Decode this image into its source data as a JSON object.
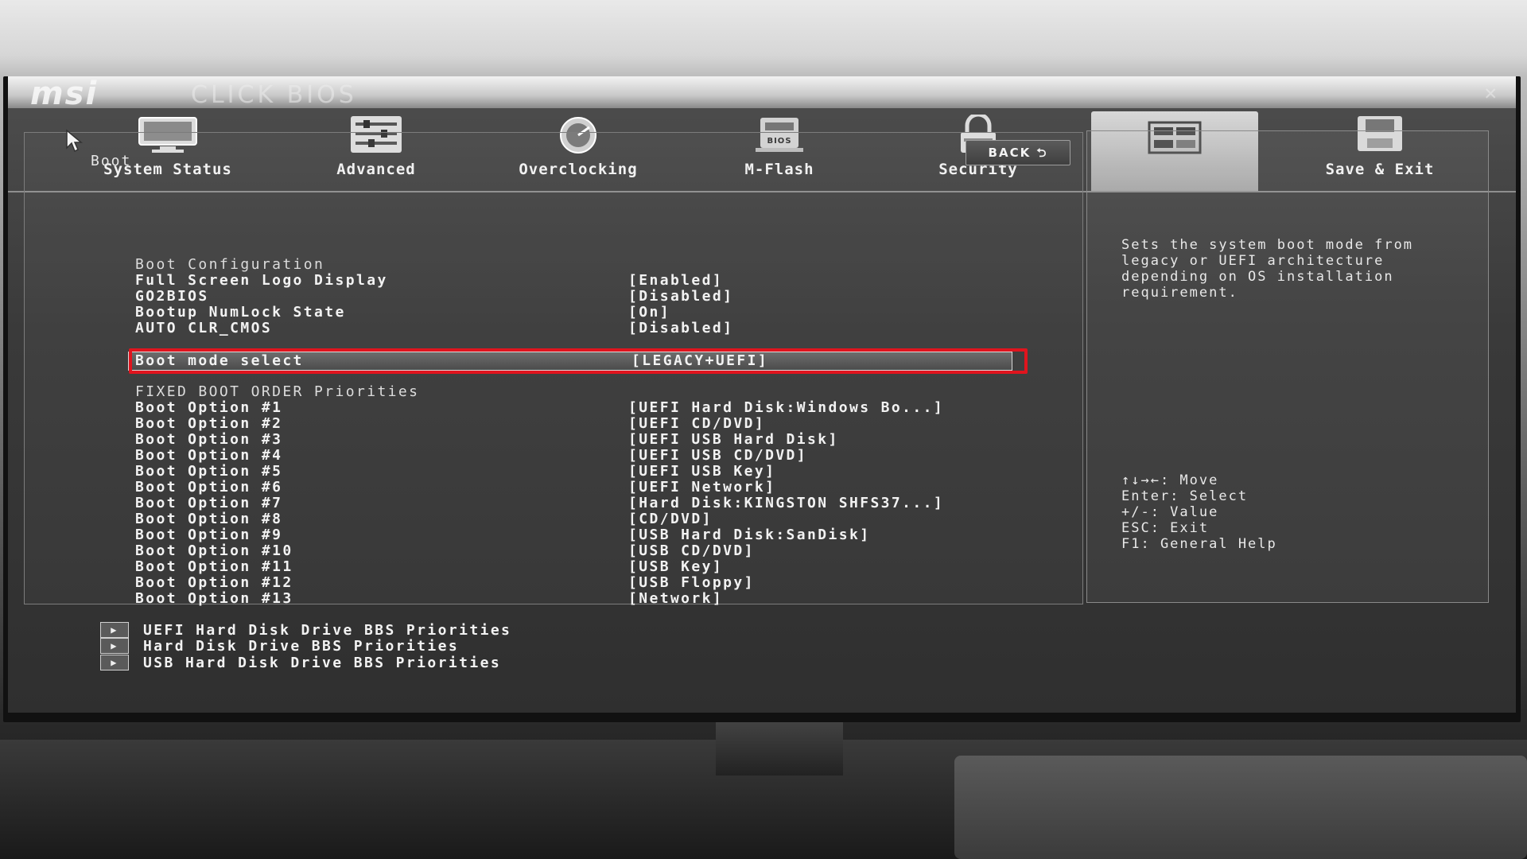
{
  "brand": {
    "logo": "msi",
    "subtitle": "CLICK BIOS",
    "close_icon": "close-icon"
  },
  "tabs": [
    {
      "label": "System Status",
      "icon": "monitor-icon"
    },
    {
      "label": "Advanced",
      "icon": "sliders-icon"
    },
    {
      "label": "Overclocking",
      "icon": "gauge-icon"
    },
    {
      "label": "M-Flash",
      "icon": "bios-chip-icon"
    },
    {
      "label": "Security",
      "icon": "lock-icon"
    },
    {
      "label": "",
      "icon": "boot-icon",
      "active": true
    },
    {
      "label": "Save & Exit",
      "icon": "disk-icon"
    }
  ],
  "boot": {
    "section_title": "Boot",
    "back_label": "BACK ⮌",
    "config_header": "Boot Configuration",
    "settings": [
      {
        "label": "Full Screen Logo Display",
        "value": "[Enabled]"
      },
      {
        "label": "GO2BIOS",
        "value": "[Disabled]"
      },
      {
        "label": "Bootup NumLock State",
        "value": "[On]"
      },
      {
        "label": "AUTO CLR_CMOS",
        "value": "[Disabled]"
      }
    ],
    "selected": {
      "label": "Boot mode select",
      "value": "[LEGACY+UEFI]"
    },
    "priorities_header": "FIXED BOOT ORDER Priorities",
    "options": [
      {
        "label": "Boot Option #1",
        "value": "[UEFI Hard Disk:Windows Bo...]"
      },
      {
        "label": "Boot Option #2",
        "value": "[UEFI CD/DVD]"
      },
      {
        "label": "Boot Option #3",
        "value": "[UEFI USB Hard Disk]"
      },
      {
        "label": "Boot Option #4",
        "value": "[UEFI USB CD/DVD]"
      },
      {
        "label": "Boot Option #5",
        "value": "[UEFI USB Key]"
      },
      {
        "label": "Boot Option #6",
        "value": "[UEFI Network]"
      },
      {
        "label": "Boot Option #7",
        "value": "[Hard Disk:KINGSTON SHFS37...]"
      },
      {
        "label": "Boot Option #8",
        "value": "[CD/DVD]"
      },
      {
        "label": "Boot Option #9",
        "value": "[USB Hard Disk:SanDisk]"
      },
      {
        "label": "Boot Option #10",
        "value": "[USB CD/DVD]"
      },
      {
        "label": "Boot Option #11",
        "value": "[USB Key]"
      },
      {
        "label": "Boot Option #12",
        "value": "[USB Floppy]"
      },
      {
        "label": "Boot Option #13",
        "value": "[Network]"
      }
    ],
    "submenus": [
      "UEFI Hard Disk Drive BBS Priorities",
      "Hard Disk Drive BBS Priorities",
      "USB Hard Disk Drive BBS Priorities"
    ]
  },
  "help": {
    "description": "Sets the system boot mode from legacy or UEFI architecture depending on OS installation requirement.",
    "keys": [
      "↑↓→←: Move",
      "Enter: Select",
      "+/-: Value",
      "ESC: Exit",
      "F1: General Help"
    ]
  },
  "colors": {
    "highlight": "#e0141e",
    "text": "#f2f2f2",
    "panel": "#3a3a3a"
  }
}
